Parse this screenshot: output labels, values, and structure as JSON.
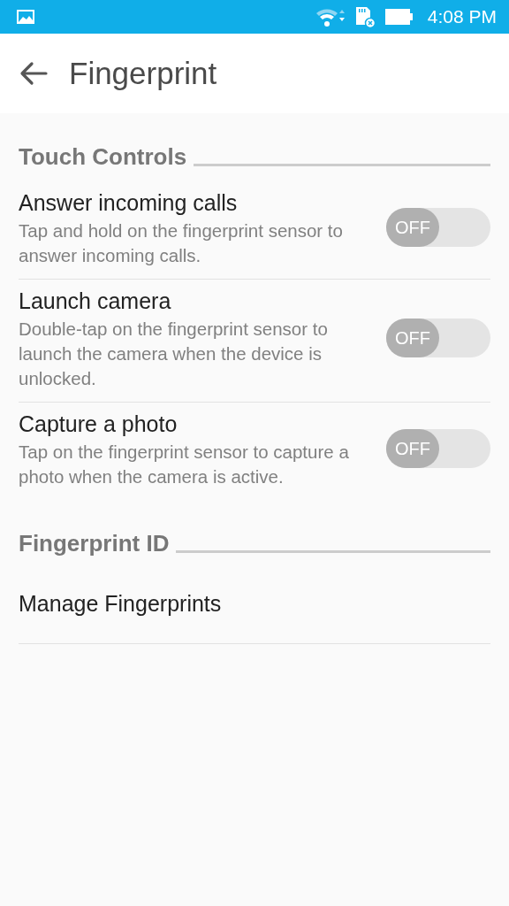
{
  "status_bar": {
    "time": "4:08 PM"
  },
  "toolbar": {
    "title": "Fingerprint"
  },
  "sections": [
    {
      "title": "Touch Controls",
      "items": [
        {
          "kind": "toggle",
          "title": "Answer incoming calls",
          "description": "Tap and hold on the fingerprint sensor to answer incoming calls.",
          "on": false,
          "switch_label": "OFF"
        },
        {
          "kind": "toggle",
          "title": "Launch camera",
          "description": "Double-tap on the fingerprint sensor to launch the camera when the device is unlocked.",
          "on": false,
          "switch_label": "OFF"
        },
        {
          "kind": "toggle",
          "title": "Capture a photo",
          "description": "Tap on the fingerprint sensor to capture a photo when the camera is active.",
          "on": false,
          "switch_label": "OFF"
        }
      ]
    },
    {
      "title": "Fingerprint ID",
      "items": [
        {
          "kind": "link",
          "title": "Manage Fingerprints"
        }
      ]
    }
  ]
}
